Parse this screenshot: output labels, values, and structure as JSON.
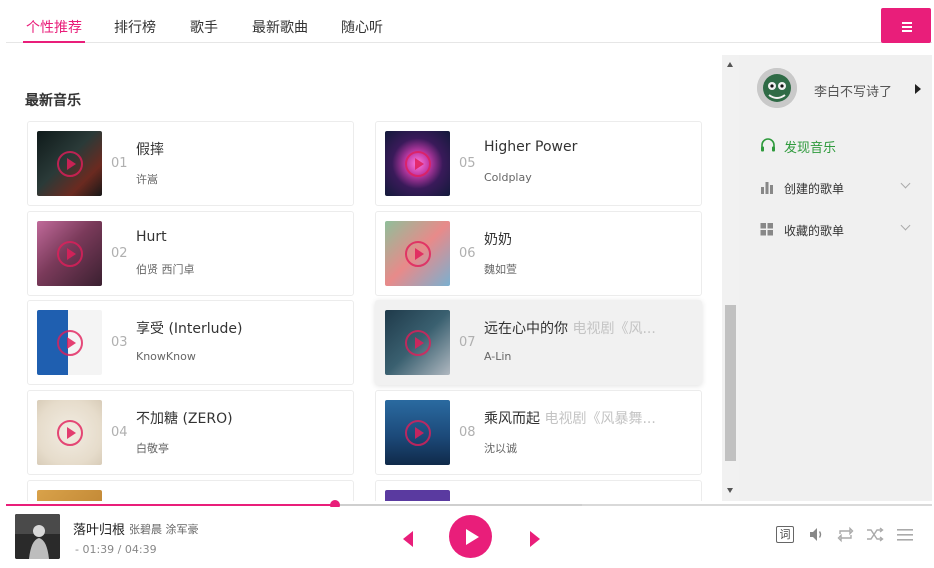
{
  "nav": {
    "tabs": [
      {
        "label": "个性推荐",
        "active": true
      },
      {
        "label": "排行榜"
      },
      {
        "label": "歌手"
      },
      {
        "label": "最新歌曲"
      },
      {
        "label": "随心听"
      }
    ],
    "menu_icon": "hamburger-icon",
    "accent": "#e91e7a"
  },
  "section": {
    "title": "最新音乐"
  },
  "songs": [
    {
      "no": "01",
      "title": "假摔",
      "note": "",
      "artist": "许嵩",
      "cover_color": "#1c2a2a"
    },
    {
      "no": "02",
      "title": "Hurt",
      "note": "",
      "artist": "伯贤 西门卓",
      "cover_color": "#7a3a5a"
    },
    {
      "no": "03",
      "title": "享受 (Interlude)",
      "note": "",
      "artist": "KnowKnow",
      "cover_color": "#1f5fb0"
    },
    {
      "no": "04",
      "title": "不加糖 (ZERO)",
      "note": "",
      "artist": "白敬亭",
      "cover_color": "#e8ded0"
    },
    {
      "no": "05",
      "title": "Higher Power",
      "note": "",
      "artist": "Coldplay",
      "cover_color": "#121a3a"
    },
    {
      "no": "06",
      "title": "奶奶",
      "note": "",
      "artist": "魏如萱",
      "cover_color": "#8fbf9a"
    },
    {
      "no": "07",
      "title": "远在心中的你",
      "note": " 电视剧《风...",
      "artist": "A-Lin",
      "cover_color": "#2b4a5c"
    },
    {
      "no": "08",
      "title": "乘风而起",
      "note": " 电视剧《风暴舞...",
      "artist": "沈以诚",
      "cover_color": "#1c4a7a"
    }
  ],
  "sidebar": {
    "username": "李白不写诗了",
    "items": [
      {
        "label": "发现音乐",
        "icon": "headphones-icon",
        "active": true
      },
      {
        "label": "创建的歌单",
        "icon": "bar-chart-icon"
      },
      {
        "label": "收藏的歌单",
        "icon": "grid-icon"
      }
    ]
  },
  "player": {
    "title": "落叶归根",
    "artist": "张碧晨 涂军豪",
    "time": "- 01:39 / 04:39",
    "progress": 0.356,
    "lyric_label": "词",
    "icons": [
      "prev-icon",
      "play-icon",
      "next-icon",
      "lyric-icon",
      "volume-icon",
      "repeat-icon",
      "shuffle-icon",
      "playlist-icon"
    ]
  }
}
